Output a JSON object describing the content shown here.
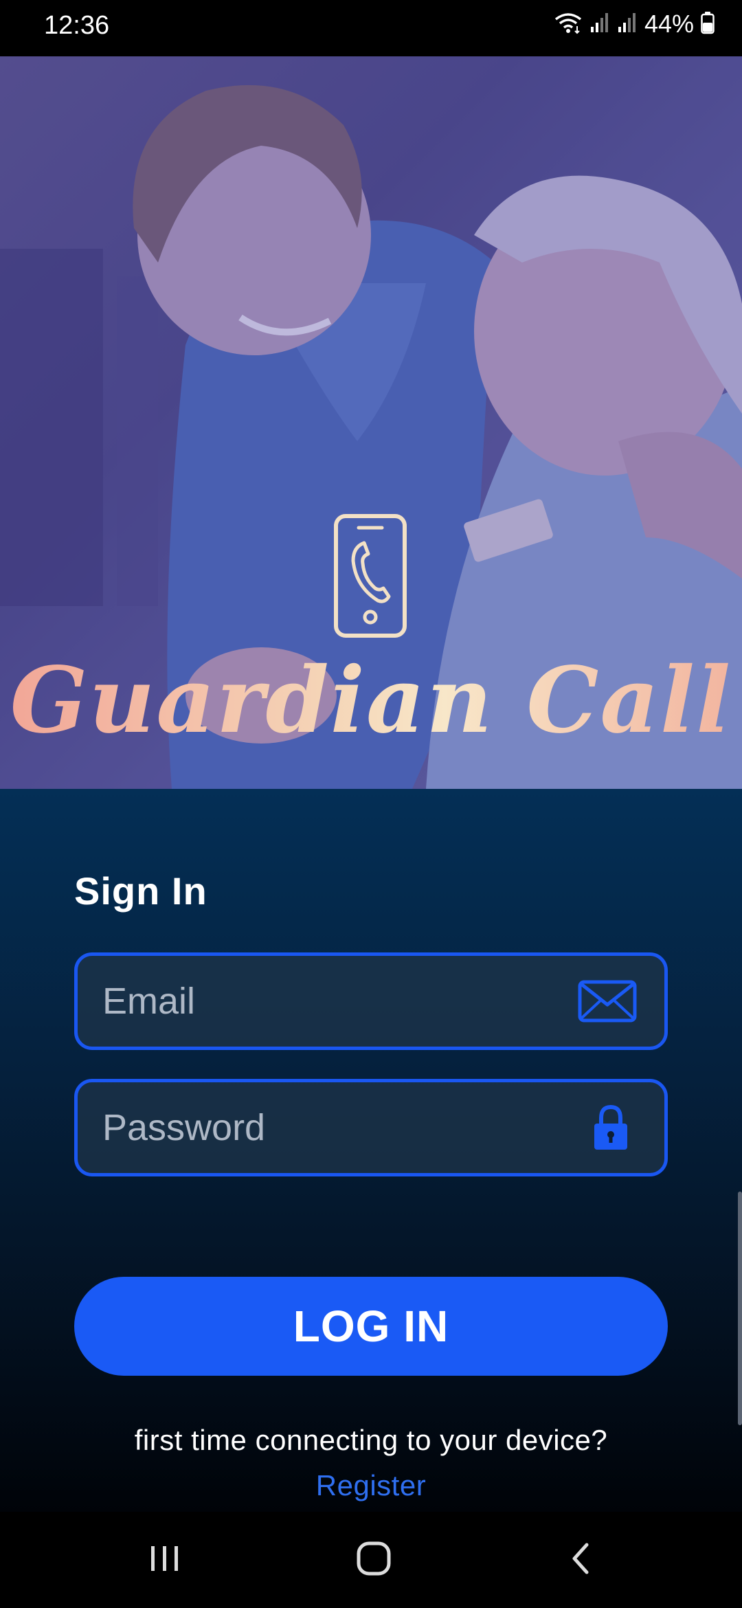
{
  "status_bar": {
    "time": "12:36",
    "battery_percent": "44%",
    "icons": [
      "wifi-icon",
      "signal-icon",
      "signal-icon",
      "battery-icon"
    ]
  },
  "hero": {
    "app_title": "Guardian Call",
    "logo_icon": "phone-call-icon"
  },
  "login": {
    "title": "Sign In",
    "email_placeholder": "Email",
    "email_value": "",
    "password_placeholder": "Password",
    "password_value": "",
    "email_icon": "envelope-icon",
    "password_icon": "lock-icon",
    "login_label": "LOG IN",
    "prompt": "first time connecting to your device?",
    "register_label": "Register"
  },
  "nav": {
    "recents": "recents-icon",
    "home": "home-icon",
    "back": "back-icon"
  },
  "colors": {
    "accent": "#1a5af5",
    "field_border": "#1a57f2",
    "link": "#2f6ff0",
    "login_bg_top": "#042f56",
    "hero_tint": "#5a5590"
  }
}
